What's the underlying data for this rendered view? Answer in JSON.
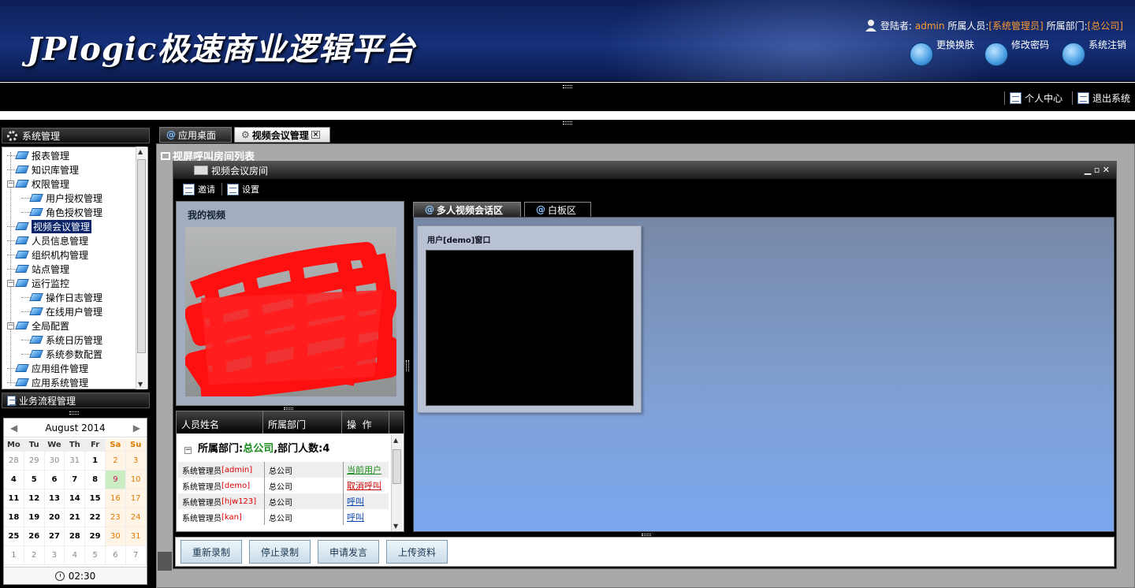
{
  "header": {
    "logo": "JPlogic极速商业逻辑平台",
    "user_info": {
      "login_label": "登陆者:",
      "login_user": "admin",
      "role_label": "所属人员:",
      "role_value": "[系统管理员]",
      "dept_label": "所属部门:",
      "dept_value": "[总公司]"
    },
    "buttons": [
      {
        "label": "更换换肤",
        "icon": "shirt-icon"
      },
      {
        "label": "修改密码",
        "icon": "key-icon"
      },
      {
        "label": "系统注销",
        "icon": "power-icon"
      }
    ]
  },
  "top_links": {
    "personal_center": "个人中心",
    "exit_system": "退出系统"
  },
  "sidebar": {
    "title": "系统管理",
    "tree": [
      {
        "label": "报表管理",
        "level": 1,
        "expander": false
      },
      {
        "label": "知识库管理",
        "level": 1,
        "expander": false
      },
      {
        "label": "权限管理",
        "level": 1,
        "expander": "minus"
      },
      {
        "label": "用户授权管理",
        "level": 2,
        "expander": false
      },
      {
        "label": "角色授权管理",
        "level": 2,
        "expander": false
      },
      {
        "label": "视频会议管理",
        "level": 1,
        "expander": false,
        "selected": true
      },
      {
        "label": "人员信息管理",
        "level": 1,
        "expander": false
      },
      {
        "label": "组织机构管理",
        "level": 1,
        "expander": false
      },
      {
        "label": "站点管理",
        "level": 1,
        "expander": false
      },
      {
        "label": "运行监控",
        "level": 1,
        "expander": "minus"
      },
      {
        "label": "操作日志管理",
        "level": 2,
        "expander": false
      },
      {
        "label": "在线用户管理",
        "level": 2,
        "expander": false
      },
      {
        "label": "全局配置",
        "level": 1,
        "expander": "minus"
      },
      {
        "label": "系统日历管理",
        "level": 2,
        "expander": false
      },
      {
        "label": "系统参数配置",
        "level": 2,
        "expander": false
      },
      {
        "label": "应用组件管理",
        "level": 1,
        "expander": false
      },
      {
        "label": "应用系统管理",
        "level": 1,
        "expander": false
      }
    ],
    "business_title": "业务流程管理"
  },
  "calendar": {
    "month_label": "August 2014",
    "day_names": [
      "Mo",
      "Tu",
      "We",
      "Th",
      "Fr",
      "Sa",
      "Su"
    ],
    "weeks": [
      [
        "28",
        "29",
        "30",
        "31",
        "1",
        "2",
        "3"
      ],
      [
        "4",
        "5",
        "6",
        "7",
        "8",
        "9",
        "10"
      ],
      [
        "11",
        "12",
        "13",
        "14",
        "15",
        "16",
        "17"
      ],
      [
        "18",
        "19",
        "20",
        "21",
        "22",
        "23",
        "24"
      ],
      [
        "25",
        "26",
        "27",
        "28",
        "29",
        "30",
        "31"
      ],
      [
        "1",
        "2",
        "3",
        "4",
        "5",
        "6",
        "7"
      ]
    ],
    "today": "9",
    "time": "02:30"
  },
  "main_tabs": [
    {
      "label": "应用桌面",
      "active": false
    },
    {
      "label": "视频会议管理",
      "active": true
    }
  ],
  "background_panel_title": "视屏呼叫房间列表",
  "window": {
    "title": "视频会议房间",
    "toolbar": [
      {
        "label": "邀请"
      },
      {
        "label": "设置"
      }
    ],
    "my_video_title": "我的视频",
    "member_table": {
      "headers": [
        "人员姓名",
        "所属部门",
        "操  作"
      ],
      "group_prefix": "所属部门:",
      "group_name": "总公司",
      "group_suffix": ",部门人数:4",
      "rows": [
        {
          "role": "系统管理员",
          "user": "[admin]",
          "dept": "总公司",
          "action": "当前用户",
          "action_style": "green"
        },
        {
          "role": "系统管理员",
          "user": "[demo]",
          "dept": "总公司",
          "action": "取消呼叫",
          "action_style": "red"
        },
        {
          "role": "系统管理员",
          "user": "[hjw123]",
          "dept": "总公司",
          "action": "呼叫",
          "action_style": "blue"
        },
        {
          "role": "系统管理员",
          "user": "[kan]",
          "dept": "总公司",
          "action": "呼叫",
          "action_style": "blue"
        }
      ]
    },
    "right_tabs": [
      {
        "label": "多人视频会话区",
        "active": true
      },
      {
        "label": "白板区",
        "active": false
      }
    ],
    "user_window_title": "用户[demo]窗口",
    "bottom_buttons": [
      "重新录制",
      "停止录制",
      "申请发言",
      "上传资料"
    ]
  },
  "colors": {
    "header_bg": "#15307a",
    "highlight_orange": "#ff9a2e",
    "selected_tree": "#0a246a",
    "green_link": "#1a8a1a",
    "red_link": "#c00000",
    "blue_link": "#0645ad"
  }
}
